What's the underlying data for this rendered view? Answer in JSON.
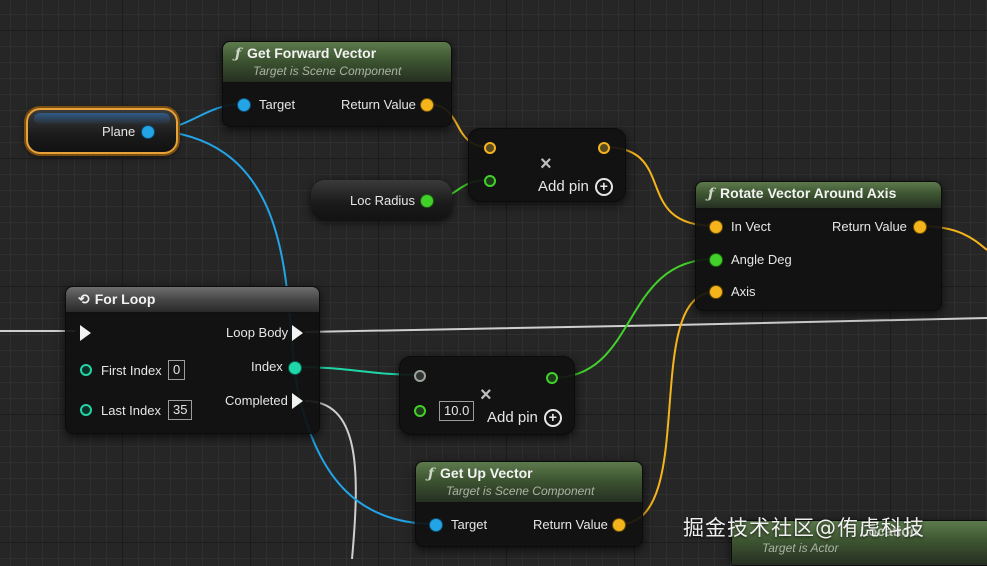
{
  "nodes": {
    "get_forward_vector": {
      "title": "Get Forward Vector",
      "subtitle": "Target is Scene Component",
      "pins": {
        "target": "Target",
        "return_value": "Return Value"
      }
    },
    "plane_var": {
      "label": "Plane"
    },
    "loc_radius_var": {
      "label": "Loc Radius"
    },
    "multiply_top": {
      "add_pin": "Add pin"
    },
    "rotate_vector": {
      "title": "Rotate Vector Around Axis",
      "pins": {
        "in_vect": "In Vect",
        "angle_deg": "Angle Deg",
        "axis": "Axis",
        "return_value": "Return Value"
      }
    },
    "for_loop": {
      "title": "For Loop",
      "pins": {
        "loop_body": "Loop Body",
        "first_index": "First Index",
        "first_index_value": "0",
        "index": "Index",
        "last_index": "Last Index",
        "last_index_value": "35",
        "completed": "Completed"
      }
    },
    "multiply_bottom": {
      "input_value": "10.0",
      "add_pin": "Add pin"
    },
    "get_up_vector": {
      "title": "Get Up Vector",
      "subtitle": "Target is Scene Component",
      "pins": {
        "target": "Target",
        "return_value": "Return Value"
      }
    },
    "partial_node": {
      "title_fragment": "Location",
      "subtitle": "Target is Actor"
    }
  },
  "icons": {
    "function": "function-icon",
    "loop": "loop-icon",
    "multiply": "multiply-icon",
    "add": "plus-circle-icon"
  },
  "colors": {
    "object_pin": "#22a4e6",
    "vector_pin": "#f4b41b",
    "float_pin": "#42d12a",
    "int_pin": "#1fd6a8",
    "exec_pin": "#f2f2f2",
    "function_header": "#4f6a42",
    "selection": "#e8a23a"
  },
  "watermark": "掘金技术社区@侑虎科技"
}
